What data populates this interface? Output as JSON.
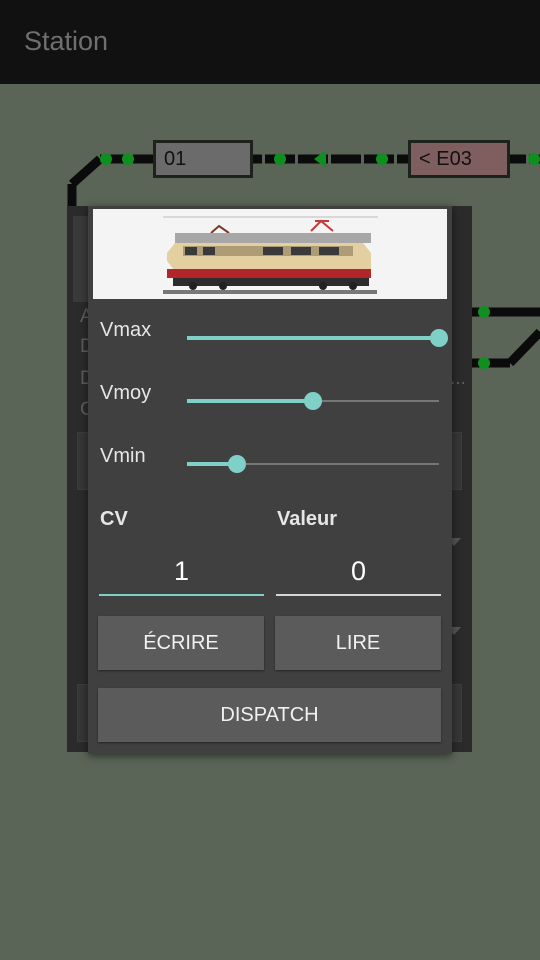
{
  "app_bar": {
    "title": "Station"
  },
  "track_blocks": [
    {
      "label": "01",
      "state": "free"
    },
    {
      "label": "< E03",
      "state": "occupied"
    }
  ],
  "background_panel": {
    "letters": [
      "A",
      "D",
      "D",
      "C"
    ],
    "ellipsis": "..."
  },
  "colors": {
    "accent": "#7fd0c6",
    "signal_green": "#0f8f1f",
    "track": "#0b0b0b",
    "dialog_bg": "#404040",
    "button_bg": "#5b5b5b"
  },
  "dialog": {
    "sliders": [
      {
        "label": "Vmax",
        "value": 1.0
      },
      {
        "label": "Vmoy",
        "value": 0.5
      },
      {
        "label": "Vmin",
        "value": 0.2
      }
    ],
    "cv_label": "CV",
    "valeur_label": "Valeur",
    "cv_value": "1",
    "valeur_value": "0",
    "write_button": "ÉCRIRE",
    "read_button": "LIRE",
    "dispatch_button": "DISPATCH"
  }
}
